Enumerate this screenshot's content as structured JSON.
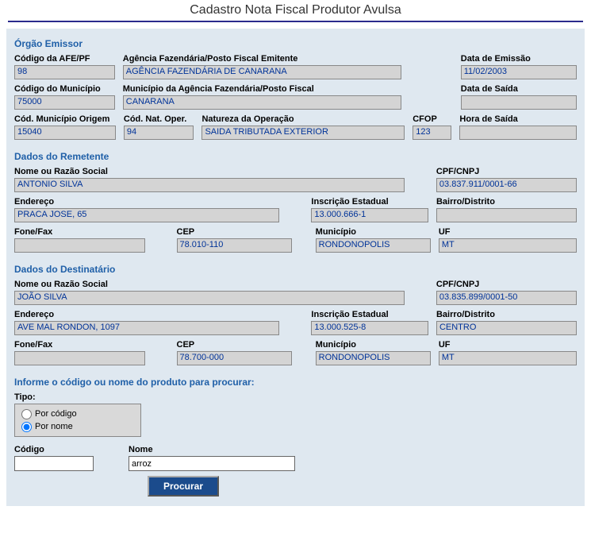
{
  "title": "Cadastro Nota Fiscal Produtor Avulsa",
  "emissor": {
    "section_title": "Órgão Emissor",
    "codigo_afe_label": "Código da AFE/PF",
    "codigo_afe_value": "98",
    "agencia_emitente_label": "Agência Fazendária/Posto Fiscal Emitente",
    "agencia_emitente_value": "AGÊNCIA FAZENDÁRIA DE CANARANA",
    "data_emissao_label": "Data de Emissão",
    "data_emissao_value": "11/02/2003",
    "codigo_municipio_label": "Código do Município",
    "codigo_municipio_value": "75000",
    "municipio_agencia_label": "Município da Agência Fazendária/Posto Fiscal",
    "municipio_agencia_value": "CANARANA",
    "data_saida_label": "Data de Saída",
    "data_saida_value": "",
    "cod_municipio_origem_label": "Cód. Município Origem",
    "cod_municipio_origem_value": "15040",
    "cod_nat_oper_label": "Cód. Nat. Oper.",
    "cod_nat_oper_value": "94",
    "natureza_operacao_label": "Natureza da Operação",
    "natureza_operacao_value": "SAIDA TRIBUTADA EXTERIOR",
    "cfop_label": "CFOP",
    "cfop_value": "123",
    "hora_saida_label": "Hora de Saída",
    "hora_saida_value": ""
  },
  "remetente": {
    "section_title": "Dados do Remetente",
    "nome_label": "Nome ou Razão Social",
    "nome_value": "ANTONIO SILVA",
    "cpf_cnpj_label": "CPF/CNPJ",
    "cpf_cnpj_value": "03.837.911/0001-66",
    "endereco_label": "Endereço",
    "endereco_value": "PRACA JOSE, 65",
    "inscricao_estadual_label": "Inscrição Estadual",
    "inscricao_estadual_value": "13.000.666-1",
    "bairro_label": "Bairro/Distrito",
    "bairro_value": "",
    "fone_fax_label": "Fone/Fax",
    "fone_fax_value": "",
    "cep_label": "CEP",
    "cep_value": "78.010-110",
    "municipio_label": "Município",
    "municipio_value": "RONDONOPOLIS",
    "uf_label": "UF",
    "uf_value": "MT"
  },
  "destinatario": {
    "section_title": "Dados do Destinatário",
    "nome_label": "Nome ou Razão Social",
    "nome_value": "JOÃO SILVA",
    "cpf_cnpj_label": "CPF/CNPJ",
    "cpf_cnpj_value": "03.835.899/0001-50",
    "endereco_label": "Endereço",
    "endereco_value": "AVE MAL RONDON,   1097",
    "inscricao_estadual_label": "Inscrição Estadual",
    "inscricao_estadual_value": "13.000.525-8",
    "bairro_label": "Bairro/Distrito",
    "bairro_value": "CENTRO",
    "fone_fax_label": "Fone/Fax",
    "fone_fax_value": "",
    "cep_label": "CEP",
    "cep_value": "78.700-000",
    "municipio_label": "Município",
    "municipio_value": "RONDONOPOLIS",
    "uf_label": "UF",
    "uf_value": "MT"
  },
  "search": {
    "prompt": "Informe o código ou nome do produto para procurar:",
    "tipo_label": "Tipo:",
    "por_codigo_label": "Por código",
    "por_nome_label": "Por nome",
    "codigo_label": "Código",
    "codigo_value": "",
    "nome_label": "Nome",
    "nome_value": "arroz",
    "procurar_label": "Procurar"
  }
}
